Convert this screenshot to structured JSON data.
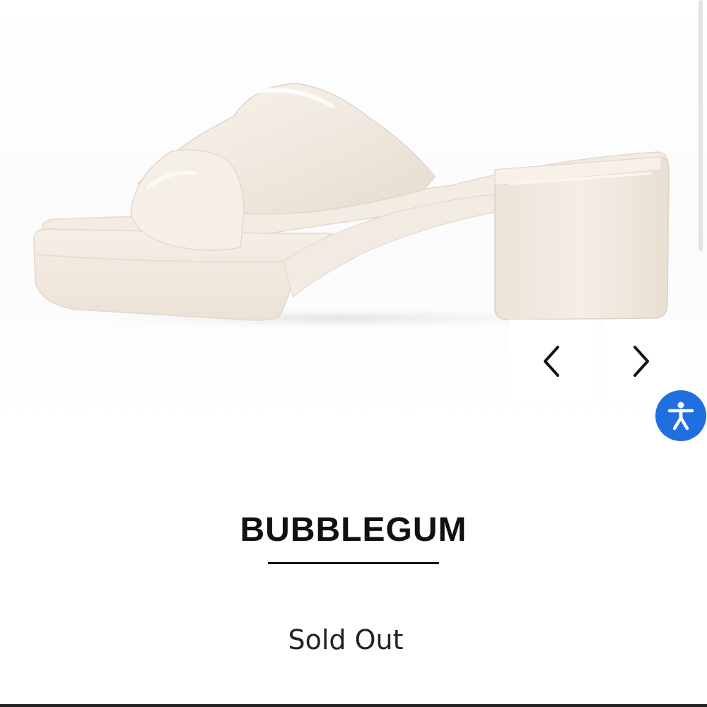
{
  "product": {
    "title": "BUBBLEGUM",
    "status": "Sold Out",
    "image": {
      "subject": "cream-colored platform block-heel slide sandal",
      "color": "#f4ede4"
    }
  },
  "carousel": {
    "prev_icon": "chevron-left-icon",
    "next_icon": "chevron-right-icon"
  },
  "accessibility": {
    "icon": "accessibility-person-icon",
    "color": "#1f6fe0"
  }
}
